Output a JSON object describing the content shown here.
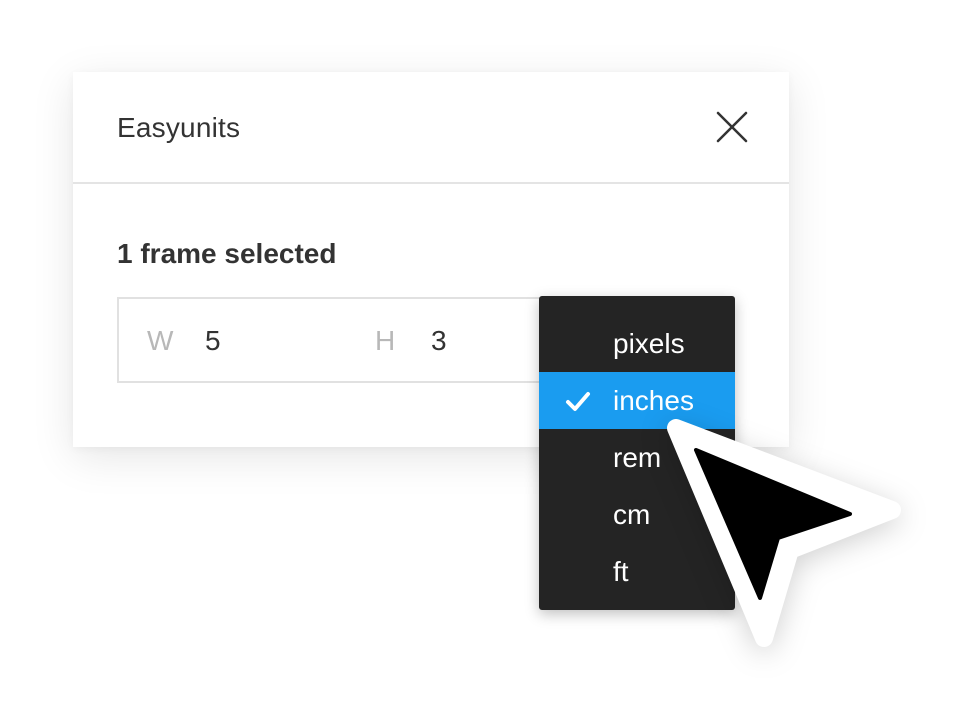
{
  "plugin": {
    "title": "Easyunits",
    "selection_text": "1 frame selected"
  },
  "dimensions": {
    "width_label": "W",
    "width_value": "5",
    "height_label": "H",
    "height_value": "3"
  },
  "unit_menu": {
    "selected": "inches",
    "options": [
      "pixels",
      "inches",
      "rem",
      "cm",
      "ft"
    ]
  },
  "icons": {
    "close": "close-icon",
    "check": "check-icon",
    "cursor": "mouse-pointer-icon"
  },
  "colors": {
    "menu_background": "#242424",
    "selected_highlight": "#1a9cf0",
    "text": "#333333",
    "muted_label": "#b8b8b8"
  }
}
